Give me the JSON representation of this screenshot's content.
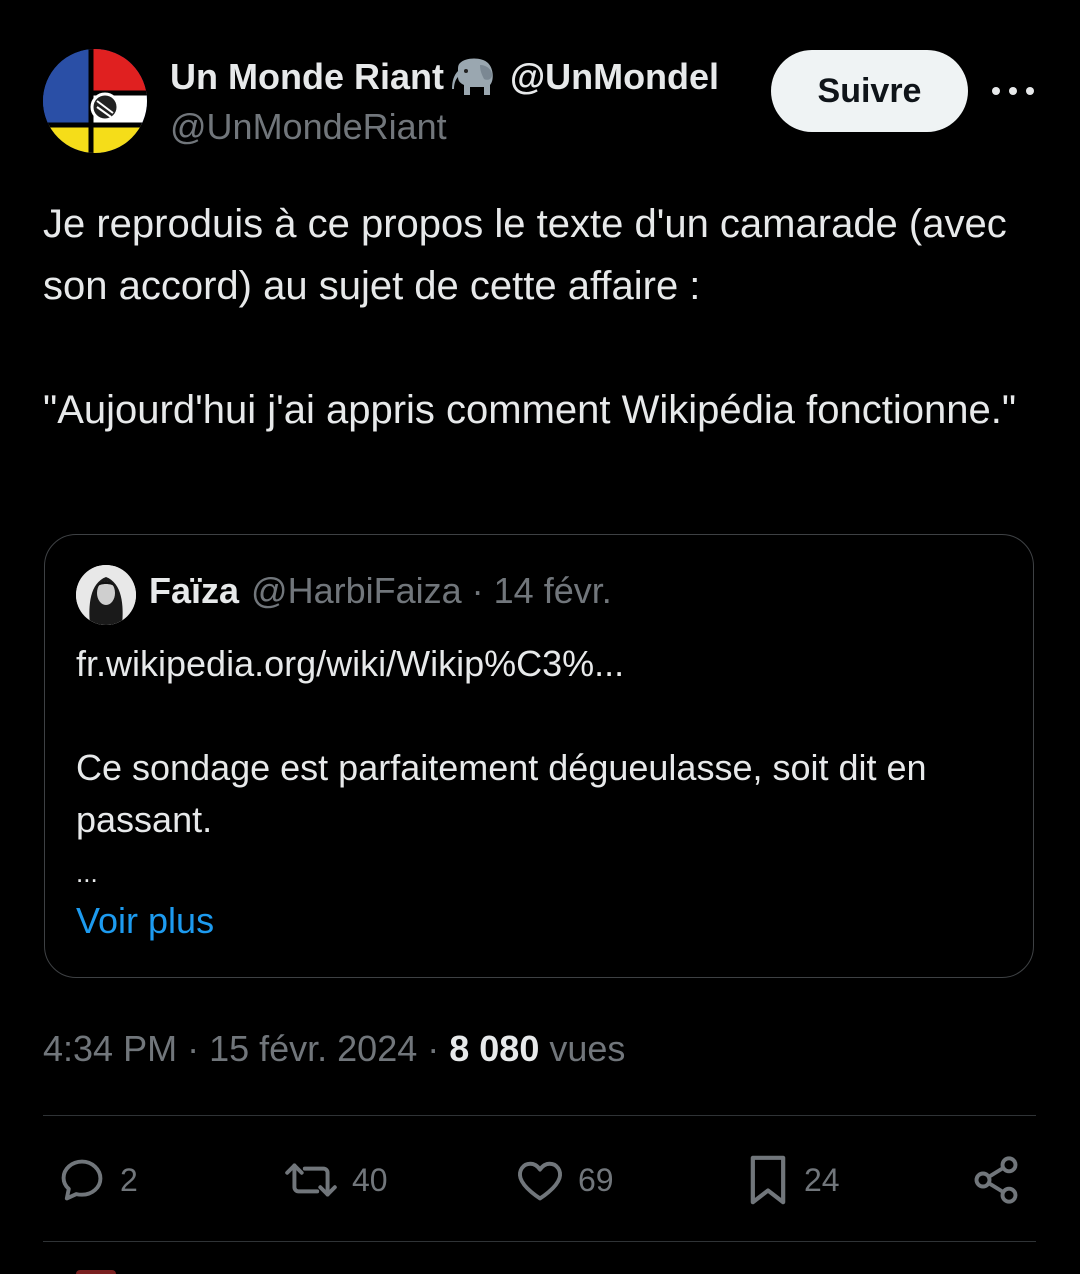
{
  "author": {
    "display_name": "Un Monde Riant",
    "handle_in_name": "@UnMondel",
    "handle": "@UnMondeRiant",
    "emoji": "elephant-icon"
  },
  "follow_label": "Suivre",
  "tweet_text": "Je reproduis à ce propos le texte d'un camarade (avec son accord) au sujet de cette affaire :\n\n\"Aujourd'hui j'ai appris comment Wikipédia fonctionne.\"",
  "quote": {
    "name": "Faïza",
    "handle": "@HarbiFaiza",
    "separator": "·",
    "date": "14 févr.",
    "link": "fr.wikipedia.org/wiki/Wikip%C3%...",
    "text": "Ce sondage est parfaitement dégueulasse, soit dit en passant.",
    "ellipsis": "...",
    "more_label": "Voir plus"
  },
  "meta": {
    "time": "4:34 PM",
    "separator": "·",
    "date": "15 févr. 2024",
    "views_count": "8 080",
    "views_label": "vues"
  },
  "actions": {
    "replies": "2",
    "reposts": "40",
    "likes": "69",
    "bookmarks": "24"
  },
  "colors": {
    "background": "#000000",
    "text": "#e7e9ea",
    "secondary": "#71767b",
    "link": "#1d9bf0",
    "border": "#2f3336"
  }
}
